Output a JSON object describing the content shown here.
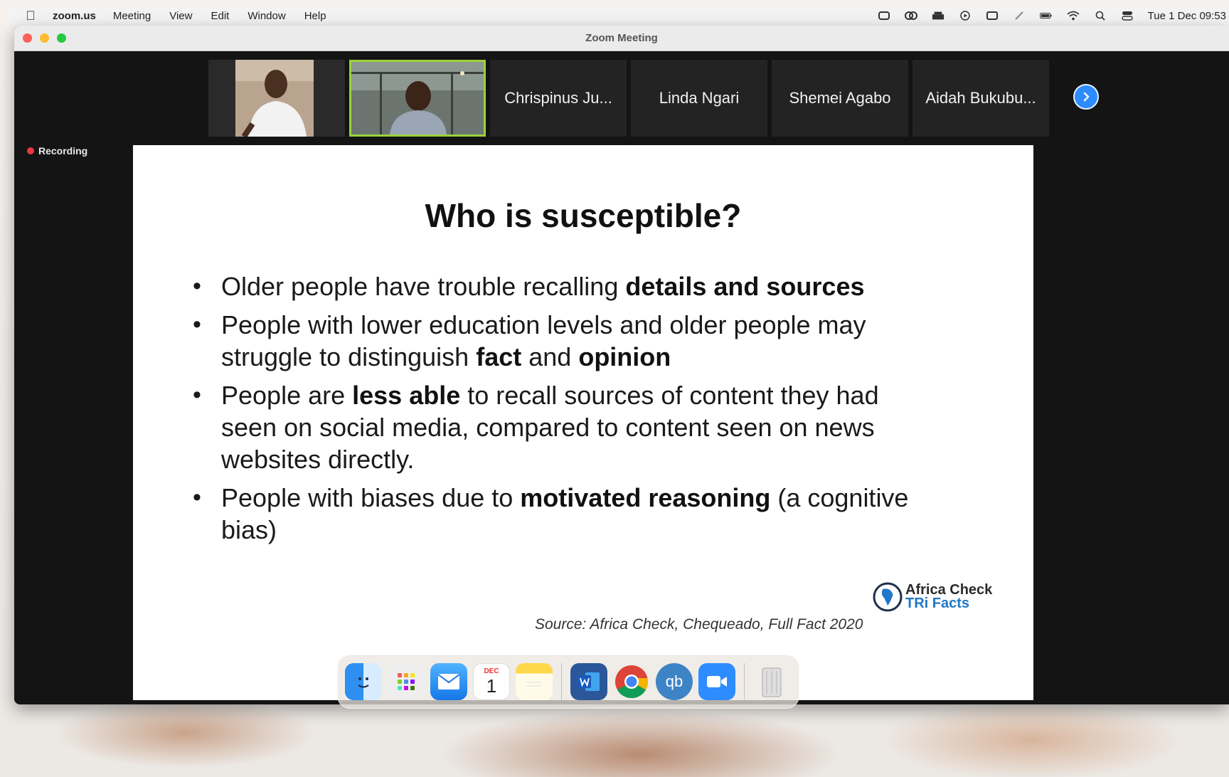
{
  "menubar": {
    "app_name": "zoom.us",
    "menus": [
      "Meeting",
      "View",
      "Edit",
      "Window",
      "Help"
    ],
    "clock": "Tue 1 Dec  09:53"
  },
  "window": {
    "title": "Zoom Meeting",
    "recording_label": "Recording"
  },
  "participants": {
    "tiles": [
      "Chrispinus Ju...",
      "Linda Ngari",
      "Shemei Agabo",
      "Aidah Bukubu..."
    ]
  },
  "slide": {
    "title": "Who is susceptible?",
    "bullets": [
      {
        "a": "Older people have trouble recalling ",
        "b": "details and sources",
        "c": ""
      },
      {
        "a": "People with lower education levels and older people may struggle to distinguish ",
        "b": "fact",
        "c": " and ",
        "d": "opinion"
      },
      {
        "a": "People are ",
        "b": "less able",
        "c": " to recall sources of content they had seen on social media, compared to content seen on news websites directly."
      },
      {
        "a": "People with biases due to ",
        "b": "motivated reasoning",
        "c": " (a cognitive bias)"
      }
    ],
    "logo_line1": "Africa Check",
    "logo_line2": "TRi Facts",
    "source": "Source: Africa Check, Chequeado, Full Fact 2020"
  },
  "colors": {
    "accent": "#2d8cff",
    "active_speaker": "#9bd23a",
    "recording": "#e8373f"
  },
  "icons": {
    "status": [
      "screen-record-icon",
      "creative-cloud-icon",
      "drive-icon",
      "play-icon",
      "display-icon",
      "pen-icon",
      "battery-icon",
      "wifi-icon",
      "search-icon",
      "control-center-icon"
    ],
    "dock": [
      "finder-icon",
      "launchpad-icon",
      "mail-icon",
      "calendar-icon",
      "notes-icon",
      "word-icon",
      "chrome-icon",
      "qbittorrent-icon",
      "zoom-icon",
      "trash-icon"
    ]
  },
  "dock": {
    "calendar_month": "DEC",
    "calendar_day": "1"
  }
}
